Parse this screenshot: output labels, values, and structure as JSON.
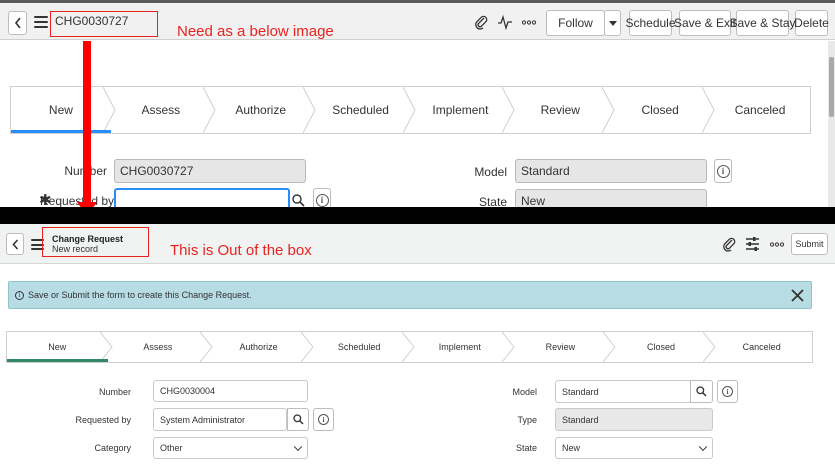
{
  "annotations": {
    "top_note": "Need as a below image",
    "bottom_note": "This is Out of the box",
    "accent_color": "#e8231f"
  },
  "top": {
    "record_number": "CHG0030727",
    "header_buttons": {
      "follow": "Follow",
      "schedule": "Schedule",
      "save_exit": "Save & Exit",
      "save_stay": "Save & Stay",
      "delete": "Delete"
    },
    "icons": [
      "back-icon",
      "hamburger-icon",
      "paperclip-icon",
      "activity-icon",
      "more-icon",
      "dropdown-caret-icon"
    ],
    "steps": [
      "New",
      "Assess",
      "Authorize",
      "Scheduled",
      "Implement",
      "Review",
      "Closed",
      "Canceled"
    ],
    "active_step": "New",
    "fields": {
      "number_label": "Number",
      "number_value": "CHG0030727",
      "requested_by_label": "Requested by",
      "requested_by_value": "",
      "model_label": "Model",
      "model_value": "Standard",
      "state_label": "State",
      "state_value": "New"
    }
  },
  "bottom": {
    "title": "Change Request",
    "subtitle": "New record",
    "submit_label": "Submit",
    "banner_text": "Save or Submit the form to create this Change Request.",
    "steps": [
      "New",
      "Assess",
      "Authorize",
      "Scheduled",
      "Implement",
      "Review",
      "Closed",
      "Canceled"
    ],
    "active_step": "New",
    "active_color": "#2e8a64",
    "fields": {
      "number_label": "Number",
      "number_value": "CHG0030004",
      "requested_by_label": "Requested by",
      "requested_by_value": "System Administrator",
      "category_label": "Category",
      "category_value": "Other",
      "model_label": "Model",
      "model_value": "Standard",
      "type_label": "Type",
      "type_value": "Standard",
      "state_label": "State",
      "state_value": "New"
    }
  }
}
